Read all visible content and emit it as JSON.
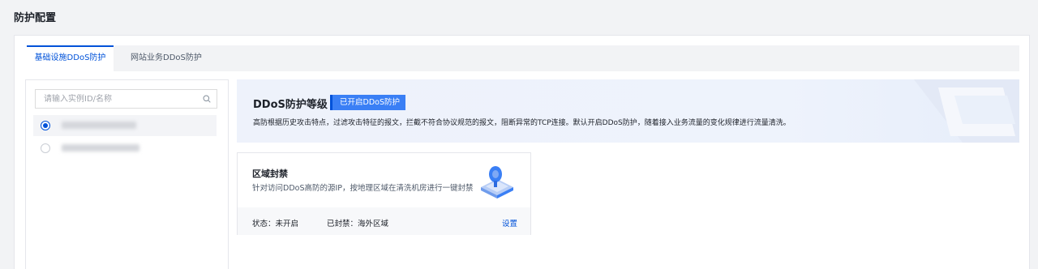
{
  "page": {
    "title": "防护配置"
  },
  "tabs": [
    {
      "label": "基础设施DDoS防护",
      "active": true
    },
    {
      "label": "网站业务DDoS防护",
      "active": false
    }
  ],
  "instances": {
    "search_placeholder": "请输入实例ID/名称",
    "items": [
      {
        "selected": true
      },
      {
        "selected": false
      }
    ]
  },
  "banner": {
    "title": "DDoS防护等级",
    "badge": "已开启DDoS防护",
    "description": "高防根据历史攻击特点，过滤攻击特征的报文，拦截不符合协议规范的报文，阻断异常的TCP连接。默认开启DDoS防护，随着接入业务流量的变化规律进行流量清洗。"
  },
  "region_block": {
    "title": "区域封禁",
    "description": "针对访问DDoS高防的源IP，按地理区域在清洗机房进行一键封禁",
    "status_label": "状态：",
    "status_value": "未开启",
    "blocked_label": "已封禁：",
    "blocked_value": "海外区域",
    "settings_link": "设置"
  },
  "colors": {
    "accent": "#0052d9",
    "badge": "#3a7ff5"
  }
}
